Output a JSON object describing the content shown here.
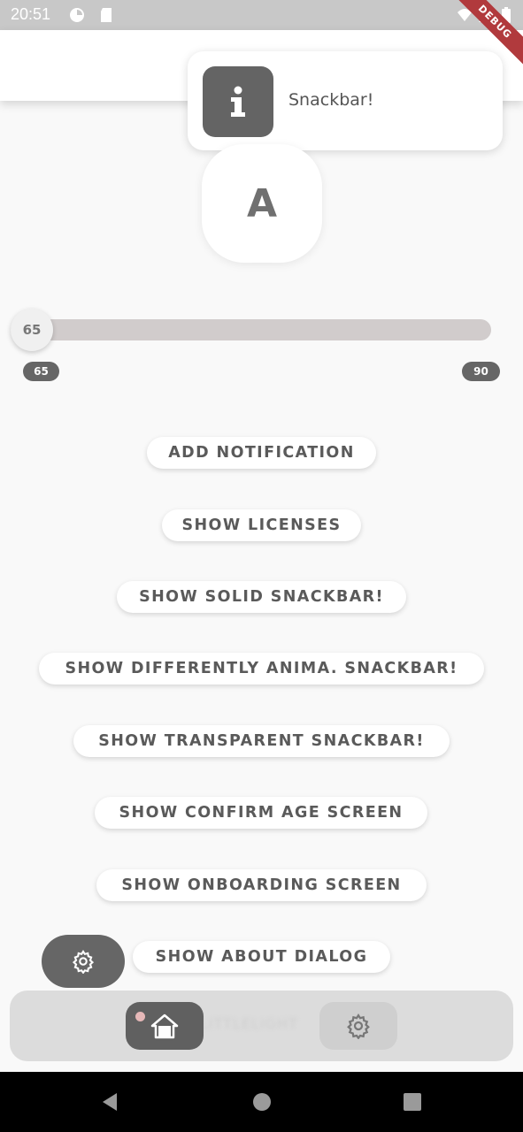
{
  "status_bar": {
    "time": "20:51",
    "icons": [
      "pie-icon",
      "sd-card-icon",
      "wifi-icon",
      "signal-icon",
      "battery-icon"
    ]
  },
  "debug_banner": "DEBUG",
  "snackbar": {
    "icon": "info-icon",
    "message": "Snackbar!"
  },
  "avatar": {
    "letter": "A"
  },
  "slider": {
    "value": 65,
    "min": 65,
    "max": 90,
    "min_label": "65",
    "max_label": "90",
    "thumb_label": "65"
  },
  "buttons": {
    "add_notification": "ADD NOTIFICATION",
    "show_licenses": "SHOW LICENSES",
    "show_solid_snackbar": "SHOW SOLID SNACKBAR!",
    "show_diff_snackbar": "SHOW DIFFERENTLY ANIMA. SNACKBAR!",
    "show_transparent_snackbar": "SHOW TRANSPARENT SNACKBAR!",
    "show_confirm_age": "SHOW CONFIRM AGE SCREEN",
    "show_onboarding": "SHOW ONBOARDING SCREEN",
    "show_about": "SHOW ABOUT DIALOG"
  },
  "fab": {
    "icon": "gear-icon"
  },
  "bottom_nav": {
    "items": [
      {
        "icon": "home-icon",
        "active": true
      },
      {
        "icon": "gear-icon",
        "active": false
      }
    ]
  },
  "colors": {
    "accent": "#666666",
    "debug": "#b13a3d",
    "track": "#d1cccc"
  }
}
